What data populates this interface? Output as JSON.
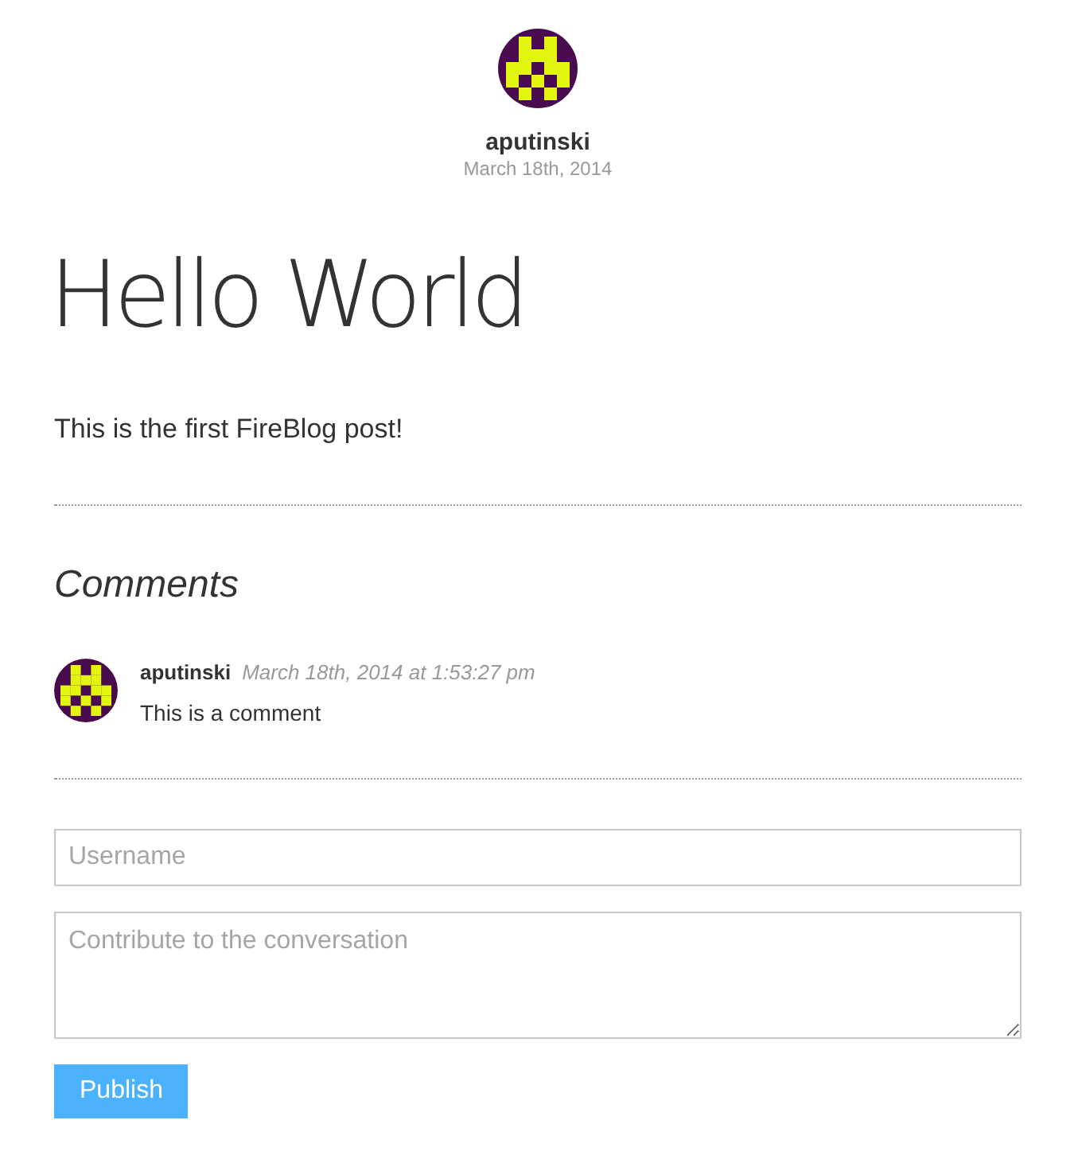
{
  "author": {
    "name": "aputinski",
    "date": "March 18th, 2014"
  },
  "post": {
    "title": "Hello World",
    "body": "This is the first FireBlog post!"
  },
  "comments_section": {
    "heading": "Comments",
    "comments": [
      {
        "author": "aputinski",
        "time": "March 18th, 2014 at 1:53:27 pm",
        "text": "This is a comment"
      }
    ]
  },
  "form": {
    "username": {
      "placeholder": "Username"
    },
    "message": {
      "placeholder": "Contribute to the conversation"
    },
    "submit": "Publish"
  }
}
